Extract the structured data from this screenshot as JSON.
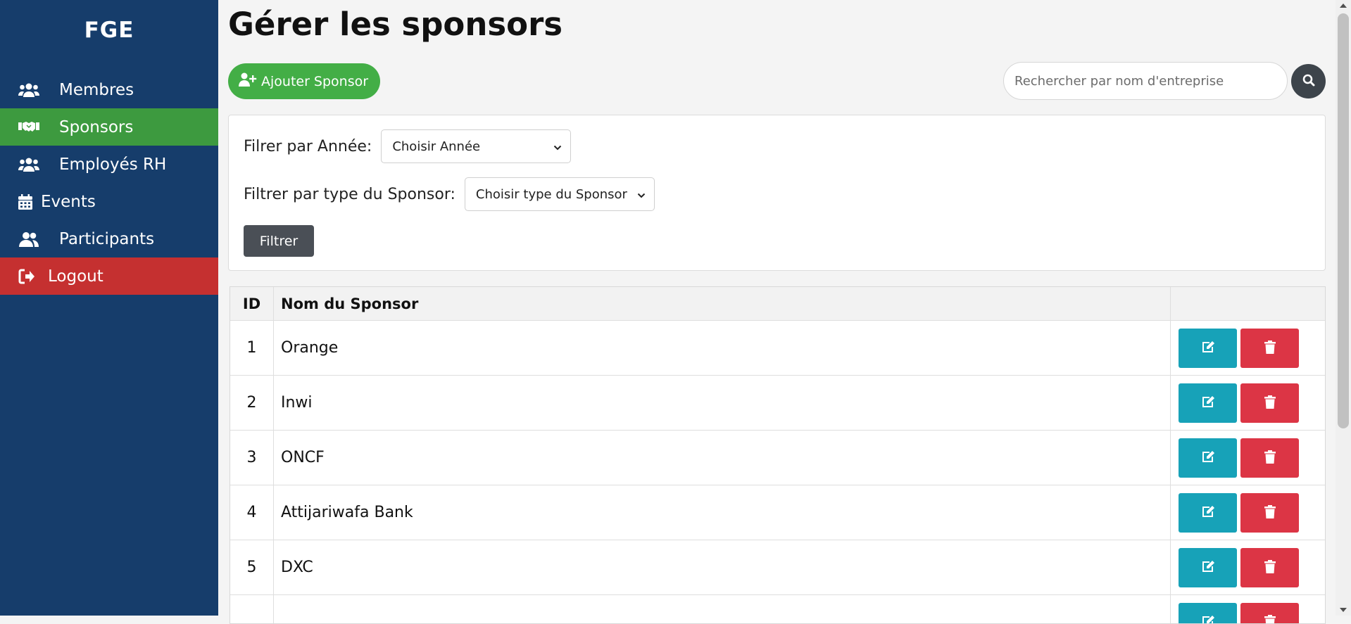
{
  "sidebar": {
    "brand": "FGE",
    "items": [
      {
        "label": "Membres",
        "icon": "users-icon"
      },
      {
        "label": "Sponsors",
        "icon": "handshake-icon"
      },
      {
        "label": "Employés RH",
        "icon": "users-icon"
      },
      {
        "label": "Events",
        "icon": "calendar-icon"
      },
      {
        "label": "Participants",
        "icon": "user-group-icon"
      },
      {
        "label": "Logout",
        "icon": "sign-out-icon"
      }
    ],
    "active": "Sponsors",
    "colors": {
      "background": "#163d6b",
      "active": "#3d9a3f",
      "logout": "#c53030"
    }
  },
  "page": {
    "title": "Gérer les sponsors",
    "add_button": "Ajouter Sponsor",
    "search": {
      "placeholder": "Rechercher par nom d'entreprise",
      "value": ""
    }
  },
  "filters": {
    "year_label": "Filrer par Année:",
    "year_select": "Choisir Année",
    "type_label": "Filtrer par type du Sponsor:",
    "type_select": "Choisir type du Sponsor",
    "submit": "Filtrer"
  },
  "table": {
    "columns": [
      "ID",
      "Nom du Sponsor",
      ""
    ],
    "rows": [
      {
        "id": "1",
        "name": "Orange"
      },
      {
        "id": "2",
        "name": "Inwi"
      },
      {
        "id": "3",
        "name": "ONCF"
      },
      {
        "id": "4",
        "name": "Attijariwafa Bank"
      },
      {
        "id": "5",
        "name": "DXC"
      },
      {
        "id": "",
        "name": ""
      }
    ],
    "action_icons": {
      "edit": "edit-icon",
      "delete": "trash-icon"
    },
    "colors": {
      "edit": "#17a2b8",
      "delete": "#dc3545"
    }
  }
}
